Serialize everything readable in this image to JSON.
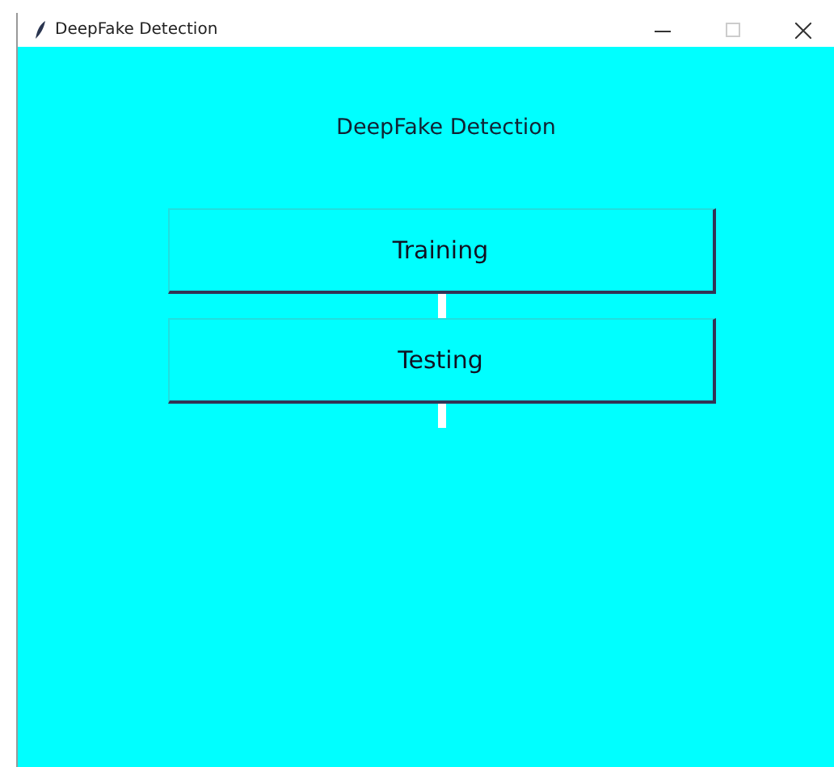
{
  "window": {
    "title": "DeepFake  Detection"
  },
  "heading": "DeepFake Detection",
  "buttons": [
    {
      "label": "Training"
    },
    {
      "label": "Testing"
    }
  ]
}
